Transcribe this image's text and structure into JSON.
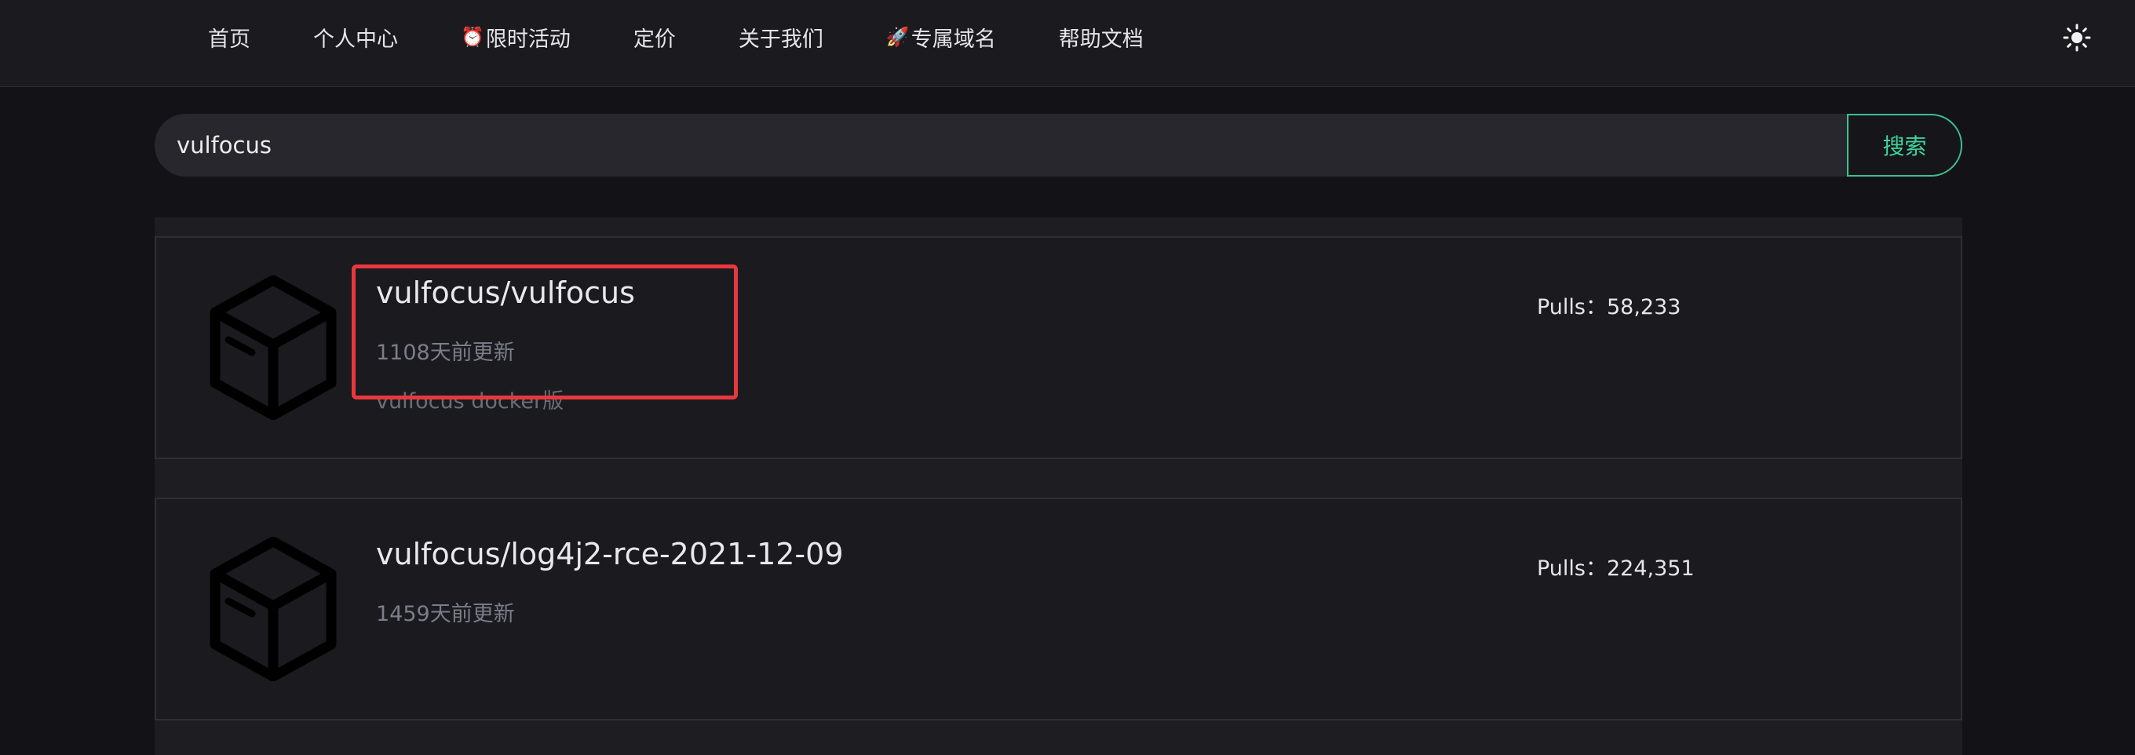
{
  "nav": {
    "items": [
      {
        "label": "首页",
        "emoji": ""
      },
      {
        "label": "个人中心",
        "emoji": ""
      },
      {
        "label": "限时活动",
        "emoji": "⏰"
      },
      {
        "label": "定价",
        "emoji": ""
      },
      {
        "label": "关于我们",
        "emoji": ""
      },
      {
        "label": "专属域名",
        "emoji": "🚀"
      },
      {
        "label": "帮助文档",
        "emoji": ""
      }
    ],
    "theme_icon": "sun-icon"
  },
  "search": {
    "value": "vulfocus",
    "placeholder": "",
    "button_label": "搜索"
  },
  "results": [
    {
      "title": "vulfocus/vulfocus",
      "updated": "1108天前更新",
      "description": "vulfocus docker版",
      "pulls": "Pulls：58,233",
      "icon": "package-box-icon"
    },
    {
      "title": "vulfocus/log4j2-rce-2021-12-09",
      "updated": "1459天前更新",
      "description": "",
      "pulls": "Pulls：224,351",
      "icon": "package-box-icon"
    }
  ],
  "colors": {
    "background": "#131217",
    "topbar": "#1b1b1f",
    "accent": "#3fd39b",
    "highlight": "#e8383d",
    "muted_text": "#7a7e8a"
  }
}
